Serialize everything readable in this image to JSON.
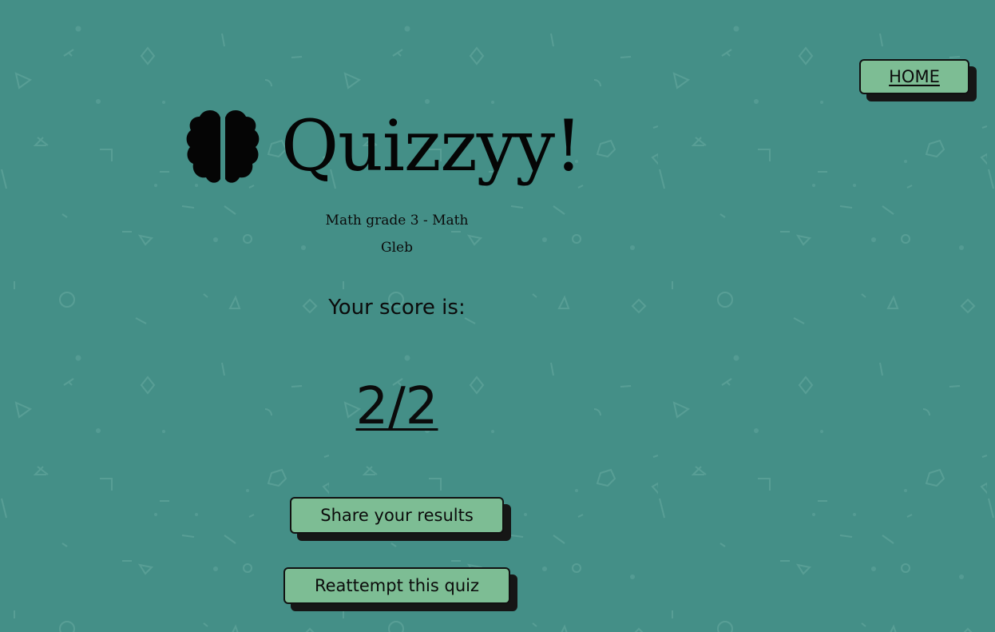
{
  "nav": {
    "home_label": "HOME"
  },
  "header": {
    "title": "Quizzyy!",
    "icon": "brain-icon"
  },
  "quiz": {
    "name": "Math grade 3 - Math",
    "author": "Gleb"
  },
  "score": {
    "label": "Your score is:",
    "value": "2/2"
  },
  "actions": {
    "share_label": "Share your results",
    "reattempt_label": "Reattempt this quiz"
  },
  "colors": {
    "background": "#448f87",
    "button": "#7dbd94",
    "shadow": "#161616",
    "text": "#0b0b0b"
  }
}
